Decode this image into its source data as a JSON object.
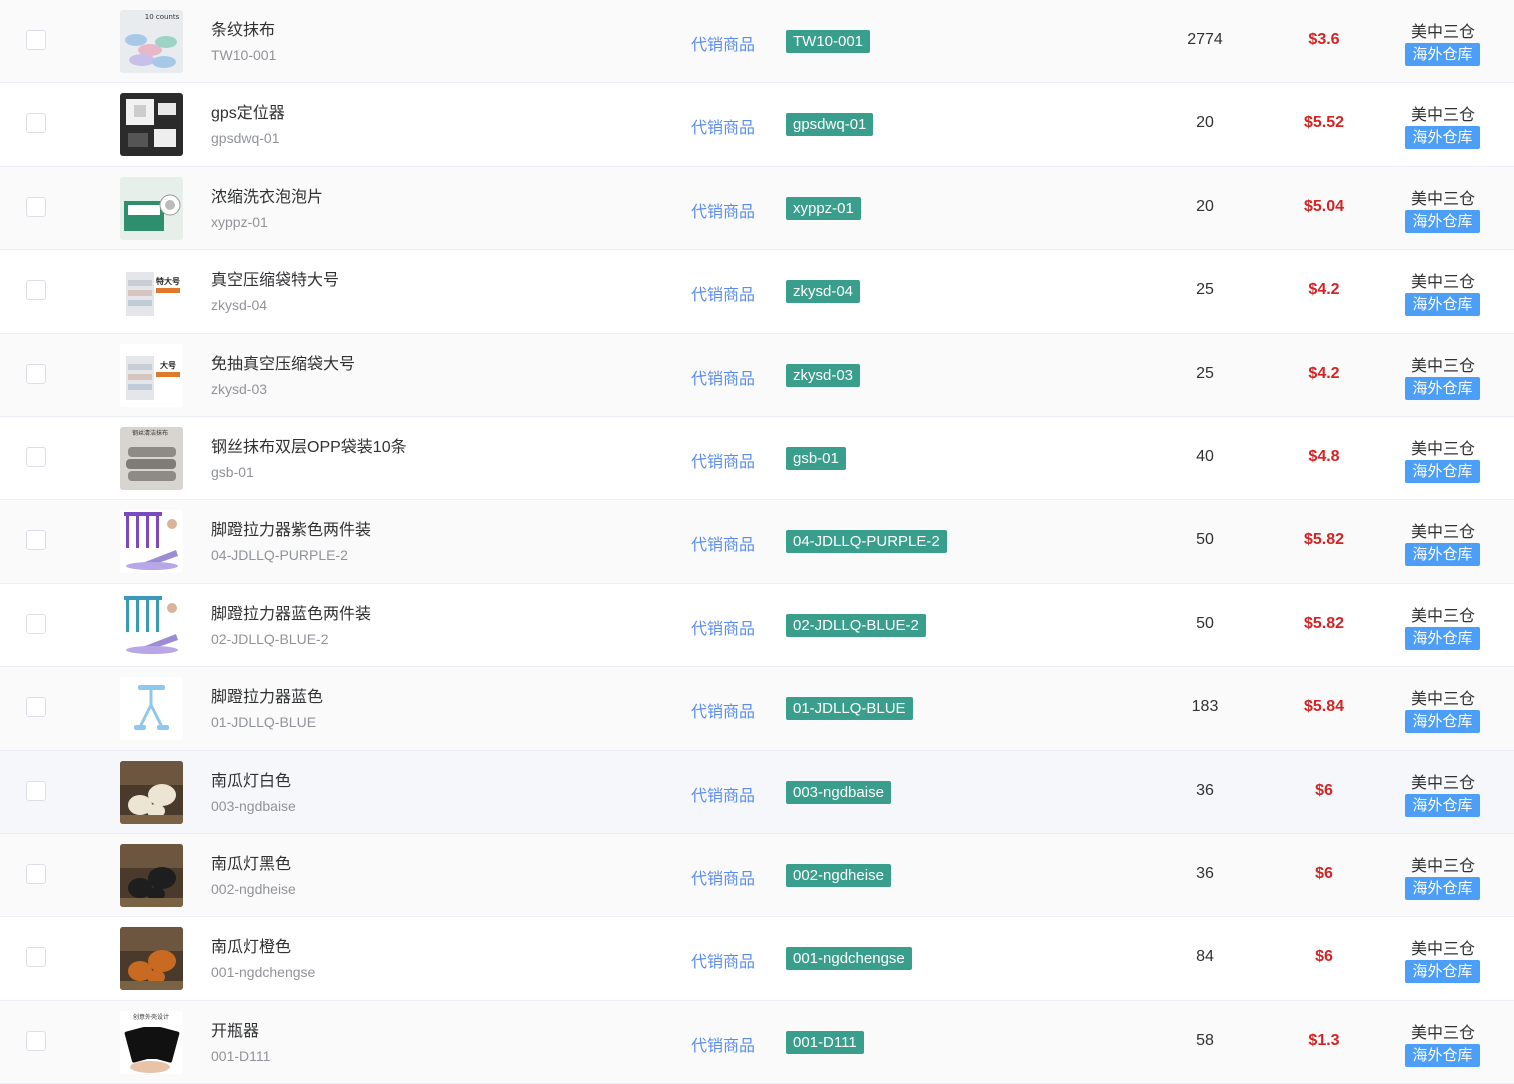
{
  "rows": [
    {
      "name": "条纹抹布",
      "code": "TW10-001",
      "type": "代销商品",
      "sku": "TW10-001",
      "qty": "2774",
      "price": "$3.6",
      "warehouse": "美中三仓",
      "warehouse_tag": "海外仓库",
      "thumb_icon": "striped-cloth-thumb",
      "thumb_text": "10 counts"
    },
    {
      "name": "gps定位器",
      "code": "gpsdwq-01",
      "type": "代销商品",
      "sku": "gpsdwq-01",
      "qty": "20",
      "price": "$5.52",
      "warehouse": "美中三仓",
      "warehouse_tag": "海外仓库",
      "thumb_icon": "gps-device-thumb"
    },
    {
      "name": "浓缩洗衣泡泡片",
      "code": "xyppz-01",
      "type": "代销商品",
      "sku": "xyppz-01",
      "qty": "20",
      "price": "$5.04",
      "warehouse": "美中三仓",
      "warehouse_tag": "海外仓库",
      "thumb_icon": "detergent-sheet-thumb"
    },
    {
      "name": "真空压缩袋特大号",
      "code": "zkysd-04",
      "type": "代销商品",
      "sku": "zkysd-04",
      "qty": "25",
      "price": "$4.2",
      "warehouse": "美中三仓",
      "warehouse_tag": "海外仓库",
      "thumb_icon": "vacuum-bag-thumb",
      "thumb_text": "特大号"
    },
    {
      "name": "免抽真空压缩袋大号",
      "code": "zkysd-03",
      "type": "代销商品",
      "sku": "zkysd-03",
      "qty": "25",
      "price": "$4.2",
      "warehouse": "美中三仓",
      "warehouse_tag": "海外仓库",
      "thumb_icon": "vacuum-bag-thumb",
      "thumb_text": "大号"
    },
    {
      "name": "钢丝抹布双层OPP袋装10条",
      "code": "gsb-01",
      "type": "代销商品",
      "sku": "gsb-01",
      "qty": "40",
      "price": "$4.8",
      "warehouse": "美中三仓",
      "warehouse_tag": "海外仓库",
      "thumb_icon": "wire-cloth-thumb",
      "thumb_text": "钢丝清洁抹布"
    },
    {
      "name": "脚蹬拉力器紫色两件装",
      "code": "04-JDLLQ-PURPLE-2",
      "type": "代销商品",
      "sku": "04-JDLLQ-PURPLE-2",
      "qty": "50",
      "price": "$5.82",
      "warehouse": "美中三仓",
      "warehouse_tag": "海外仓库",
      "thumb_icon": "pedal-puller-purple-thumb"
    },
    {
      "name": "脚蹬拉力器蓝色两件装",
      "code": "02-JDLLQ-BLUE-2",
      "type": "代销商品",
      "sku": "02-JDLLQ-BLUE-2",
      "qty": "50",
      "price": "$5.82",
      "warehouse": "美中三仓",
      "warehouse_tag": "海外仓库",
      "thumb_icon": "pedal-puller-blue-thumb"
    },
    {
      "name": "脚蹬拉力器蓝色",
      "code": "01-JDLLQ-BLUE",
      "type": "代销商品",
      "sku": "01-JDLLQ-BLUE",
      "qty": "183",
      "price": "$5.84",
      "warehouse": "美中三仓",
      "warehouse_tag": "海外仓库",
      "thumb_icon": "pedal-puller-single-thumb"
    },
    {
      "name": "南瓜灯白色",
      "code": "003-ngdbaise",
      "type": "代销商品",
      "sku": "003-ngdbaise",
      "qty": "36",
      "price": "$6",
      "warehouse": "美中三仓",
      "warehouse_tag": "海外仓库",
      "thumb_icon": "pumpkin-white-thumb"
    },
    {
      "name": "南瓜灯黑色",
      "code": "002-ngdheise",
      "type": "代销商品",
      "sku": "002-ngdheise",
      "qty": "36",
      "price": "$6",
      "warehouse": "美中三仓",
      "warehouse_tag": "海外仓库",
      "thumb_icon": "pumpkin-black-thumb"
    },
    {
      "name": "南瓜灯橙色",
      "code": "001-ngdchengse",
      "type": "代销商品",
      "sku": "001-ngdchengse",
      "qty": "84",
      "price": "$6",
      "warehouse": "美中三仓",
      "warehouse_tag": "海外仓库",
      "thumb_icon": "pumpkin-orange-thumb"
    },
    {
      "name": "开瓶器",
      "code": "001-D111",
      "type": "代销商品",
      "sku": "001-D111",
      "qty": "58",
      "price": "$1.3",
      "warehouse": "美中三仓",
      "warehouse_tag": "海外仓库",
      "thumb_icon": "bottle-opener-thumb",
      "thumb_text": "创意外壳设计"
    }
  ],
  "colors": {
    "type_link": "#5b8def",
    "sku_tag": "#3a9e8d",
    "price": "#d32424",
    "warehouse_tag": "#4d9ef6"
  }
}
